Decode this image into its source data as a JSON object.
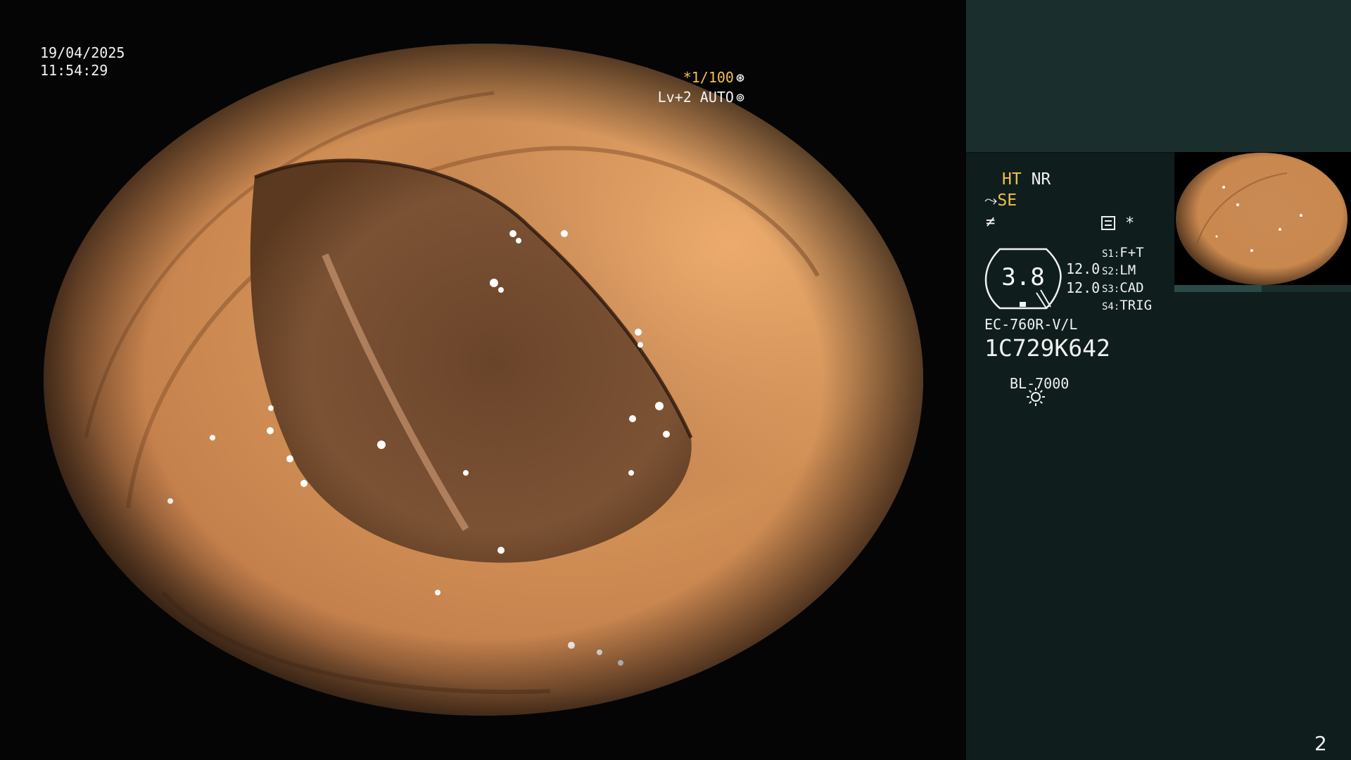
{
  "overlay": {
    "date": "19/04/2025",
    "time": "11:54:29",
    "shutter": "*1/100",
    "shutter_icon": "iris-icon",
    "level": "Lv+2 AUTO",
    "level_icon": "auto-iris-icon"
  },
  "panel": {
    "mode_ht": "HT",
    "mode_nr": "NR",
    "se_label": "SE",
    "f_label": "≠",
    "star": "*",
    "gauge_value": "3.8",
    "value_a": "12.0",
    "value_b": "12.0",
    "switches": [
      {
        "key": "S1:",
        "value": "F+T"
      },
      {
        "key": "S2:",
        "value": "LM"
      },
      {
        "key": "S3:",
        "value": "CAD"
      },
      {
        "key": "S4:",
        "value": "TRIG"
      }
    ],
    "scope_model": "EC-760R-V/L",
    "serial": "1C729K642",
    "light_source": "BL-7000",
    "page_number": "2"
  },
  "colors": {
    "accent": "#f2c04a",
    "panel_bg": "#0f1e1d",
    "panel_header_bg": "#1a2f2d",
    "tissue": "#c98a4e"
  }
}
